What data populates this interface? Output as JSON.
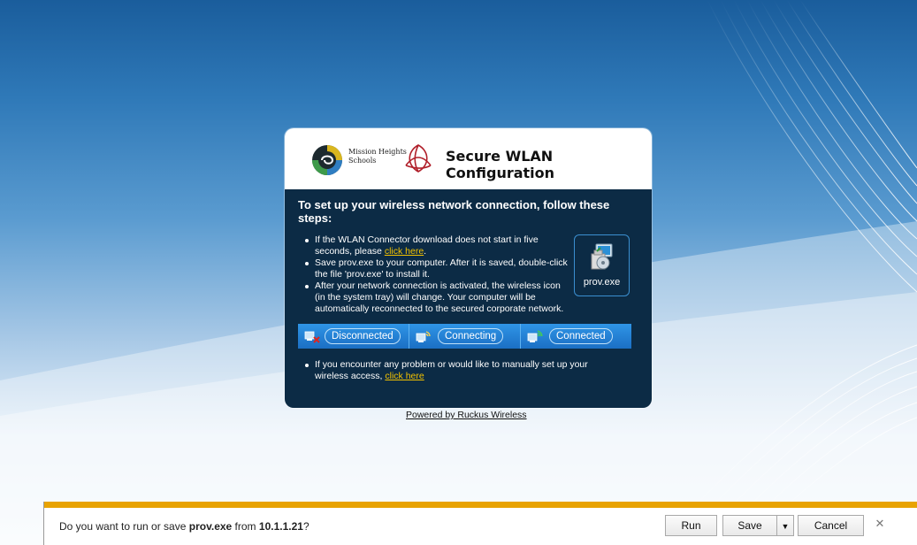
{
  "card": {
    "org_name_line1": "Mission Heights",
    "org_name_line2": "Schools",
    "title": "Secure WLAN Configuration",
    "steps_title": "To set up your wireless network connection, follow these steps:",
    "bullet1_prefix": "If the WLAN Connector download does not start in five seconds, please ",
    "bullet1_link": "click here",
    "bullet1_suffix": ".",
    "bullet2": "Save prov.exe to your computer. After it is saved, double-click the file 'prov.exe' to install it.",
    "bullet3": "After your network connection is activated, the wireless icon (in the system tray) will change. Your computer will be automatically reconnected to the secured corporate network.",
    "prov_label": "prov.exe",
    "status": {
      "disconnected": "Disconnected",
      "connecting": "Connecting",
      "connected": "Connected"
    },
    "help_prefix": "If you encounter any problem or would like to manually set up your wireless access, ",
    "help_link": "click here"
  },
  "powered_by": "Powered by Ruckus Wireless",
  "download_bar": {
    "prefix": "Do you want to run or save ",
    "file": "prov.exe",
    "middle": " from ",
    "host": "10.1.1.21",
    "suffix": "?",
    "run_label": "Run",
    "save_label": "Save",
    "dropdown_glyph": "▼",
    "cancel_label": "Cancel",
    "close_glyph": "✕"
  },
  "colors": {
    "card_body": "#0c2b45",
    "link": "#f3c200",
    "status_bar": "#1b6fc4",
    "notification_accent": "#e8a302"
  },
  "icons": [
    "school-logo-icon",
    "celtic-knot-icon",
    "installer-icon",
    "wifi-disconnected-icon",
    "wifi-connecting-icon",
    "wifi-connected-icon",
    "dropdown-arrow-icon",
    "close-icon"
  ]
}
